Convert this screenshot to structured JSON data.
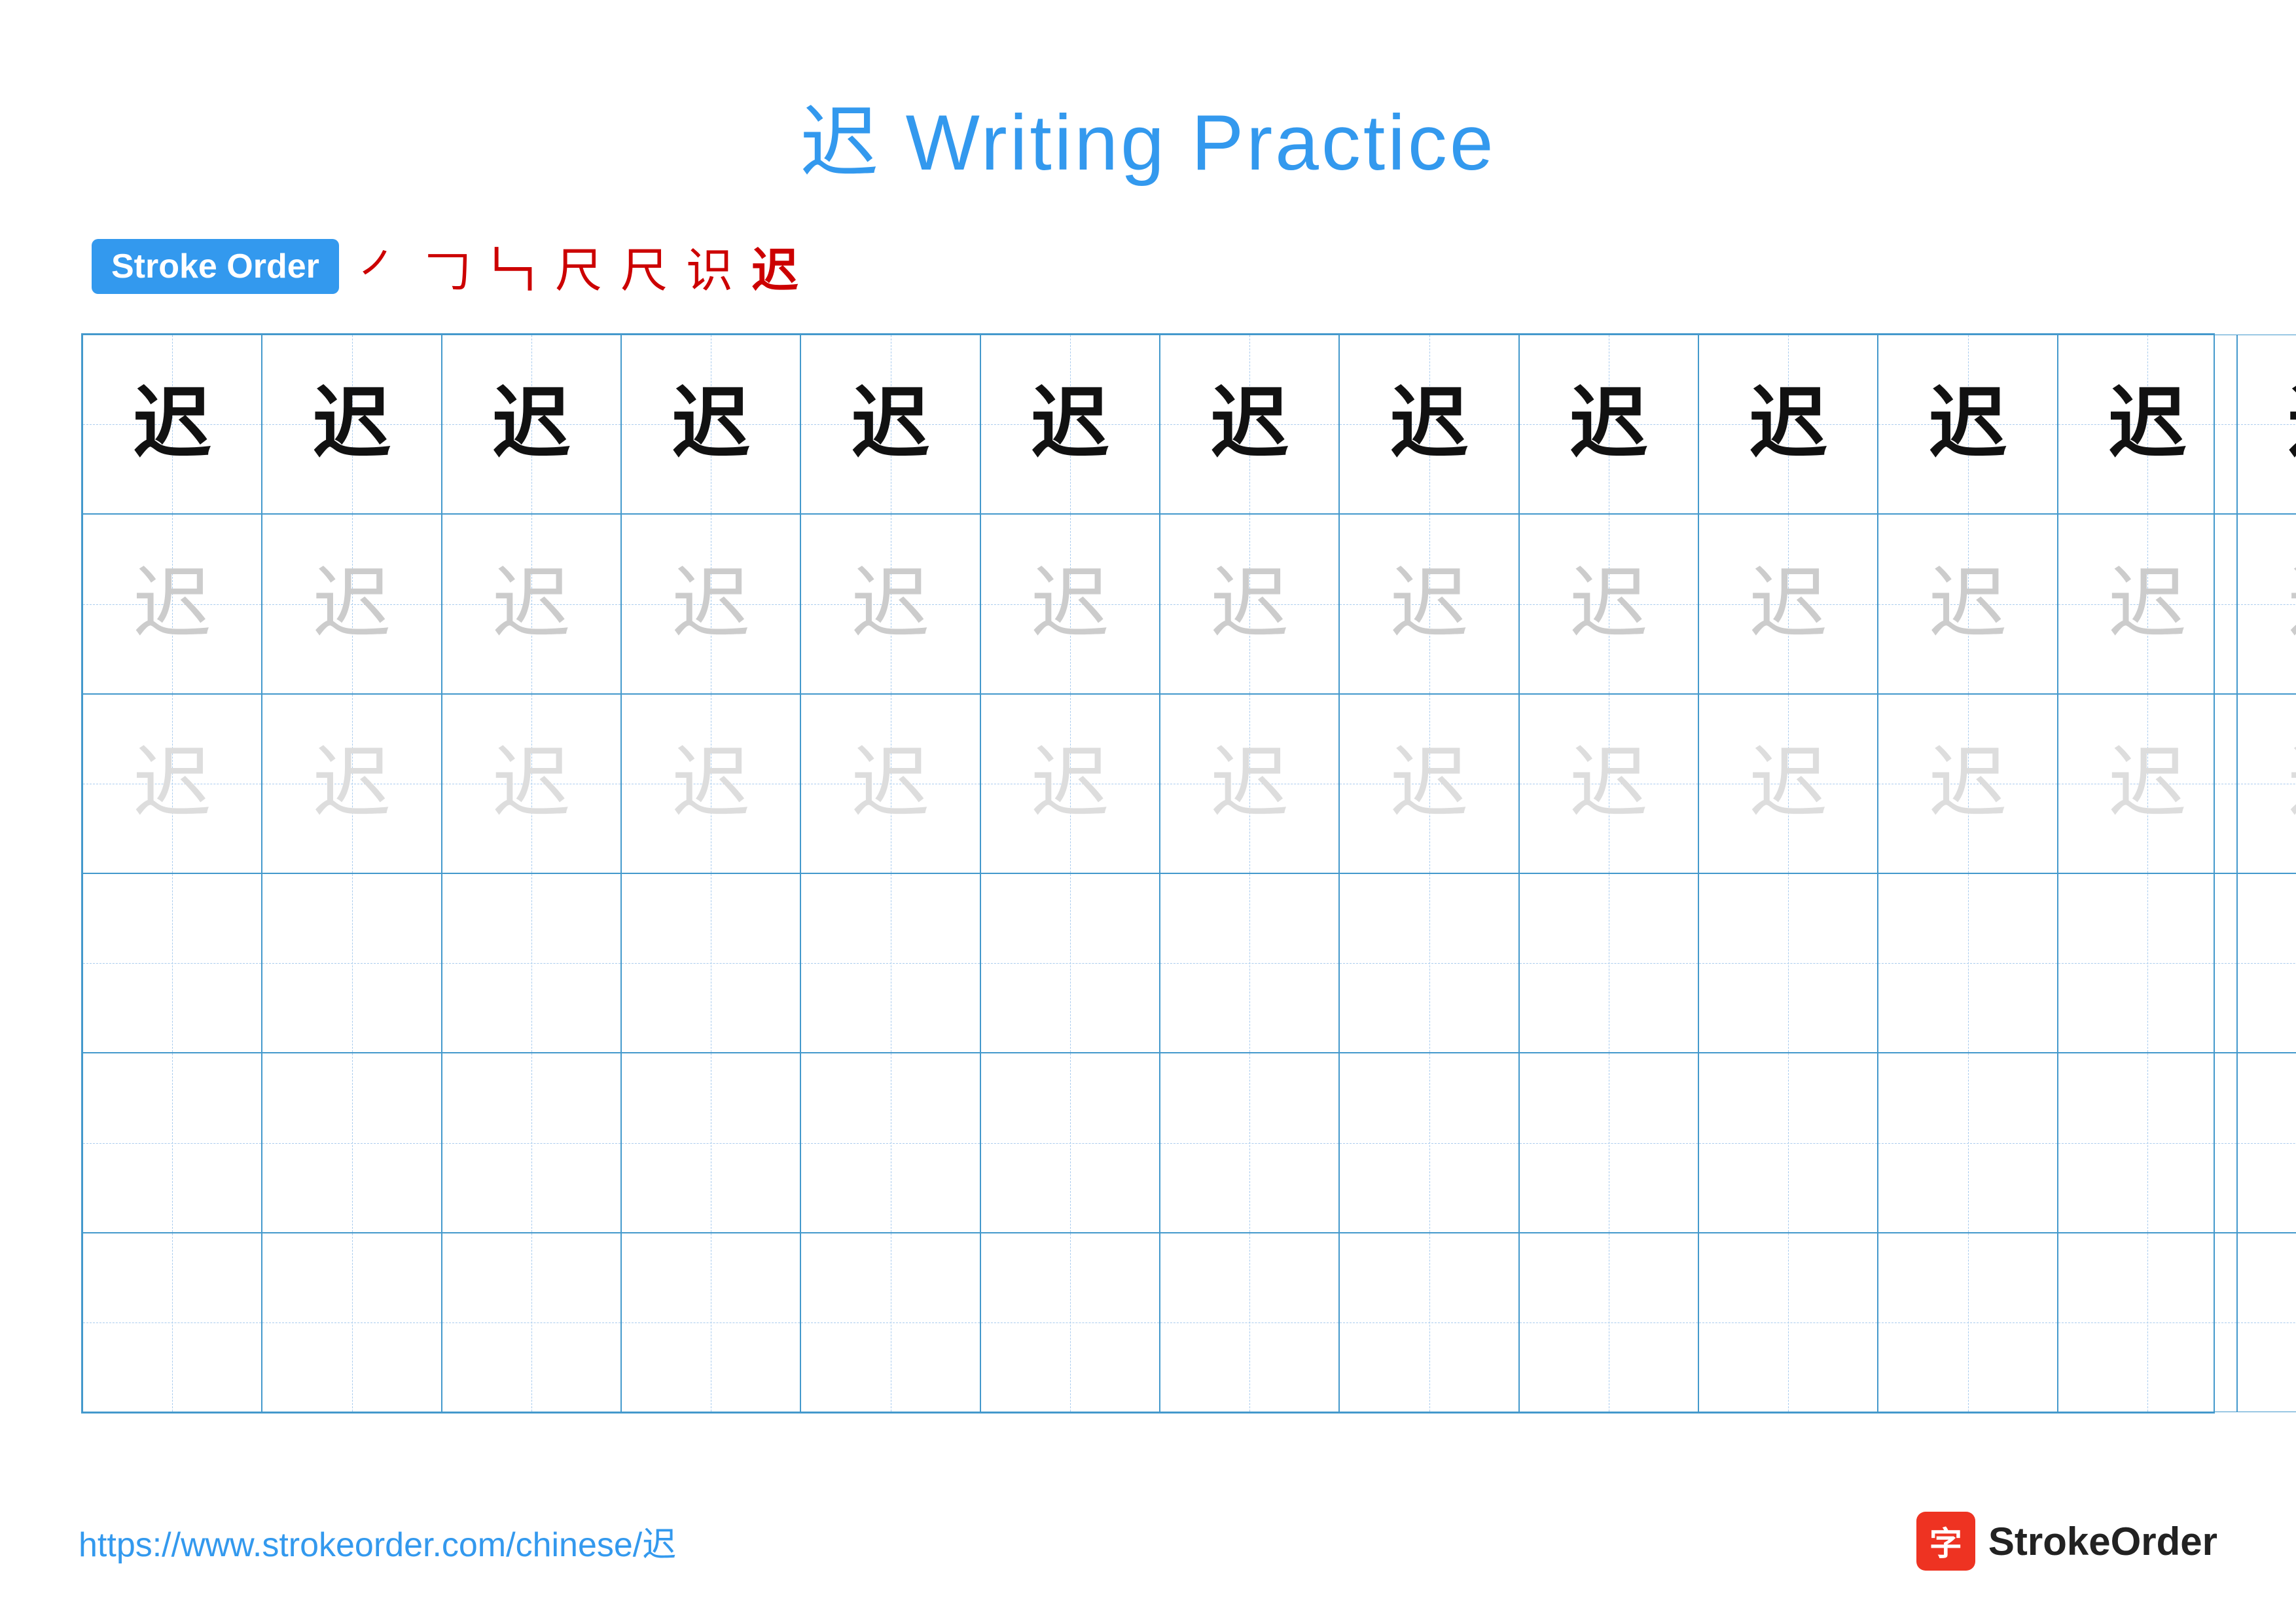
{
  "title": "迟 Writing Practice",
  "stroke_order": {
    "badge_label": "Stroke Order",
    "strokes": [
      "㇒",
      "𠃌",
      "𠃑",
      "尺",
      "尺",
      "识",
      "迟"
    ]
  },
  "character": "迟",
  "grid": {
    "cols": 13,
    "rows": 6,
    "row_styles": [
      "dark",
      "medium",
      "light",
      "empty",
      "empty",
      "empty"
    ]
  },
  "footer": {
    "url": "https://www.strokeorder.com/chinese/迟",
    "logo_char": "字",
    "logo_text": "StrokeOrder"
  }
}
